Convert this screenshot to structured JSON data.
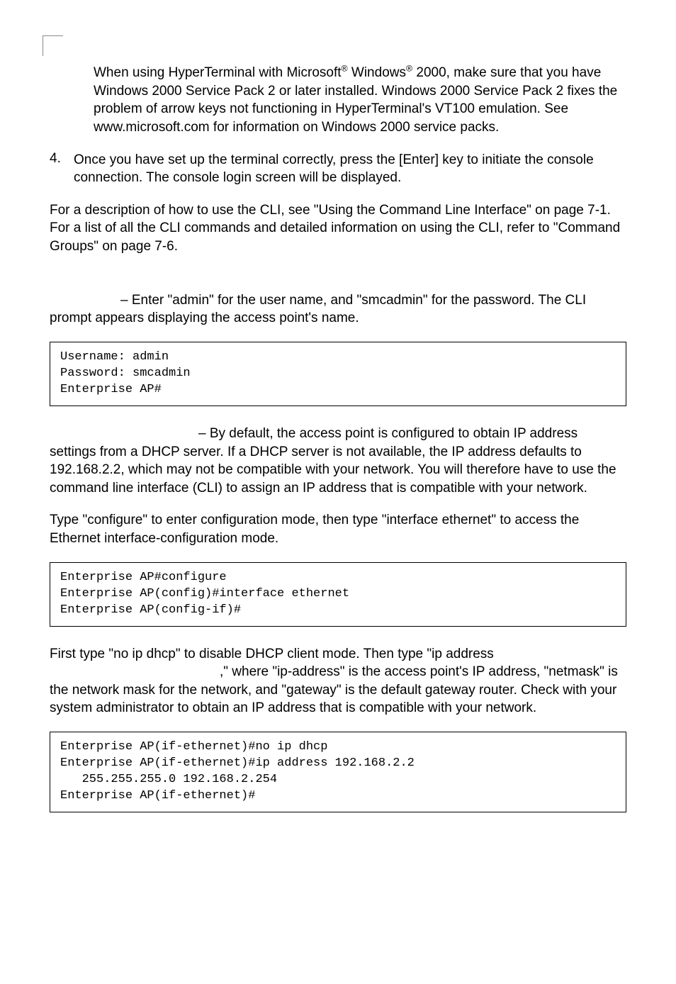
{
  "note1_part1": "When using HyperTerminal with Microsoft",
  "note1_part2": " Windows",
  "note1_part3": " 2000, make sure that you have Windows 2000 Service Pack 2 or later installed. Windows 2000 Service Pack 2 fixes the problem of arrow keys not functioning in HyperTerminal's VT100 emulation. See www.microsoft.com for information on Windows 2000 service packs.",
  "reg": "®",
  "step4_num": "4.",
  "step4_text": "Once you have set up the terminal correctly, press the [Enter] key to initiate the console connection. The console login screen will be displayed.",
  "para_cli_ref": "For a description of how to use the CLI, see \"Using the Command Line Interface\" on page 7-1. For a list of all the CLI commands and detailed information on using the CLI, refer to \"Command Groups\" on page 7-6.",
  "login_para": "– Enter \"admin\" for the user name, and \"smcadmin\" for the password. The CLI prompt appears displaying the access point's name.",
  "code_login": "Username: admin\nPassword: smcadmin\nEnterprise AP#",
  "ip_para": "– By default, the access point is configured to obtain IP address settings from a DHCP server. If a DHCP server is not available, the IP address defaults to 192.168.2.2, which may not be compatible with your network. You will therefore have to use the command line interface (CLI) to assign an IP address that is compatible with your network.",
  "configure_para": "Type \"configure\" to enter configuration mode, then type \"interface ethernet\" to access the Ethernet interface-configuration mode.",
  "code_configure": "Enterprise AP#configure\nEnterprise AP(config)#interface ethernet\nEnterprise AP(config-if)#",
  "dhcp_para_l1": "First type \"no ip dhcp\" to disable DHCP client mode. Then type \"ip address ",
  "dhcp_para_l2": ",\" where \"ip-address\" is the access point's IP address, \"netmask\" is the network mask for the network, and \"gateway\" is the default gateway router. Check with your system administrator to obtain an IP address that is compatible with your network.",
  "code_dhcp": "Enterprise AP(if-ethernet)#no ip dhcp\nEnterprise AP(if-ethernet)#ip address 192.168.2.2 \n   255.255.255.0 192.168.2.254\nEnterprise AP(if-ethernet)#"
}
